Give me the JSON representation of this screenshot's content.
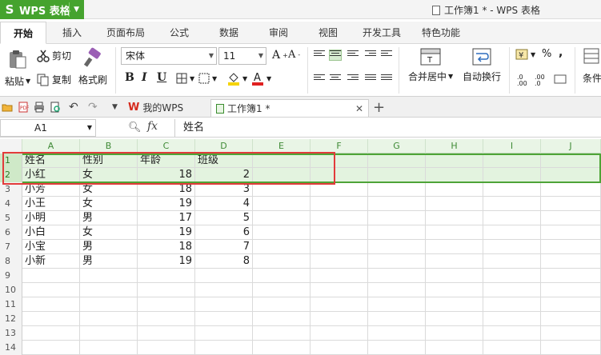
{
  "app": {
    "name": "WPS 表格",
    "logo": "S"
  },
  "window": {
    "title": "工作簿1 * - WPS 表格"
  },
  "menu_tabs": [
    "开始",
    "插入",
    "页面布局",
    "公式",
    "数据",
    "审阅",
    "视图",
    "开发工具",
    "特色功能"
  ],
  "ribbon": {
    "paste": "粘贴",
    "cut": "剪切",
    "copy": "复制",
    "format_painter": "格式刷",
    "font_name": "宋体",
    "font_size": "11",
    "bold": "B",
    "italic": "I",
    "underline": "U",
    "merge_center": "合并居中",
    "wrap_text": "自动换行",
    "percent": "%",
    "condition": "条件"
  },
  "doc_tabs": [
    {
      "label": "我的WPS"
    },
    {
      "label": "工作簿1 *"
    }
  ],
  "formula_bar": {
    "cell_ref": "A1",
    "fx": "fx",
    "value": "姓名"
  },
  "sheet": {
    "columns": [
      "A",
      "B",
      "C",
      "D",
      "E",
      "F",
      "G",
      "H",
      "I",
      "J"
    ],
    "row_numbers": [
      "1",
      "2",
      "3",
      "4",
      "5",
      "6",
      "7",
      "8",
      "9",
      "10",
      "11",
      "12",
      "13",
      "14"
    ],
    "rows": [
      [
        "姓名",
        "性别",
        "年龄",
        "班级"
      ],
      [
        "小红",
        "女",
        "18",
        "2"
      ],
      [
        "小芳",
        "女",
        "18",
        "3"
      ],
      [
        "小王",
        "女",
        "19",
        "4"
      ],
      [
        "小明",
        "男",
        "17",
        "5"
      ],
      [
        "小白",
        "女",
        "19",
        "6"
      ],
      [
        "小宝",
        "男",
        "18",
        "7"
      ],
      [
        "小新",
        "男",
        "19",
        "8"
      ]
    ]
  },
  "colors": {
    "brand_green": "#45a32e",
    "highlight_red": "#e23b3b",
    "selection_green": "#4ea437"
  }
}
